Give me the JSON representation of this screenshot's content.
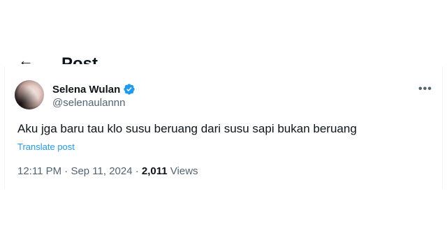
{
  "header": {
    "back_glyph": "←",
    "title": "Post"
  },
  "tweet": {
    "author": {
      "display_name": "Selena Wulan",
      "handle": "@selenaulannn",
      "verified": true
    },
    "more_glyph": "•••",
    "text": "Aku jga baru tau klo susu beruang dari susu sapi bukan beruang",
    "translate_label": "Translate post",
    "time": "12:11 PM",
    "separator": " · ",
    "date": "Sep 11, 2024",
    "views_count": "2,011",
    "views_label": " Views"
  },
  "colors": {
    "text_primary": "#0f1419",
    "text_secondary": "#536471",
    "link_blue": "#1d9bf0",
    "verified_blue": "#1d9bf0"
  },
  "icons": {
    "verified": "verified-badge-icon",
    "more": "more-options-icon",
    "back": "back-arrow-icon"
  }
}
